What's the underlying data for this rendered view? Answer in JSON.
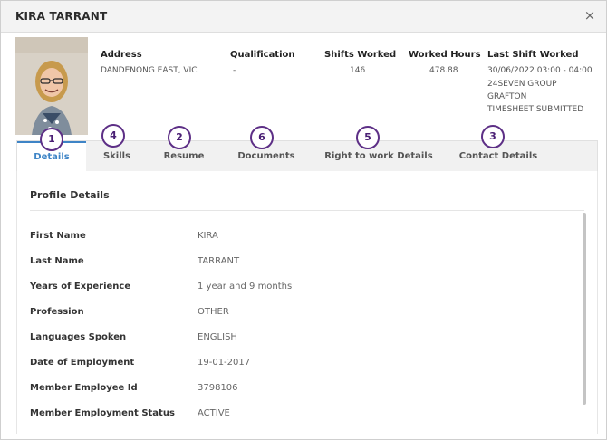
{
  "modal": {
    "title": "KIRA TARRANT",
    "close_label": "×"
  },
  "summary": {
    "address": {
      "label": "Address",
      "value": "DANDENONG EAST, VIC"
    },
    "qualification": {
      "label": "Qualification",
      "value": "-"
    },
    "shifts_worked": {
      "label": "Shifts Worked",
      "value": "146"
    },
    "worked_hours": {
      "label": "Worked Hours",
      "value": "478.88"
    },
    "last_shift": {
      "label": "Last Shift Worked",
      "value": "30/06/2022 03:00 - 04:00",
      "group": "24SEVEN GROUP",
      "location": "GRAFTON",
      "status": "TIMESHEET SUBMITTED"
    }
  },
  "tabs": [
    {
      "label": "Details",
      "badge": "1"
    },
    {
      "label": "Skills",
      "badge": "4"
    },
    {
      "label": "Resume",
      "badge": "2"
    },
    {
      "label": "Documents",
      "badge": "6"
    },
    {
      "label": "Right to work Details",
      "badge": "5"
    },
    {
      "label": "Contact Details",
      "badge": "3"
    }
  ],
  "profile": {
    "section_title": "Profile Details",
    "rows": [
      {
        "label": "First Name",
        "value": "KIRA"
      },
      {
        "label": "Last Name",
        "value": "TARRANT"
      },
      {
        "label": "Years of Experience",
        "value": "1 year and 9 months"
      },
      {
        "label": "Profession",
        "value": "OTHER"
      },
      {
        "label": "Languages Spoken",
        "value": "ENGLISH"
      },
      {
        "label": "Date of Employment",
        "value": "19-01-2017"
      },
      {
        "label": "Member Employee Id",
        "value": "3798106"
      },
      {
        "label": "Member Employment Status",
        "value": "ACTIVE"
      }
    ]
  },
  "colors": {
    "accent": "#3e84c6",
    "badge_outline": "#5d2f86"
  },
  "icons": {
    "close": "close-icon",
    "photo": "profile-photo"
  }
}
